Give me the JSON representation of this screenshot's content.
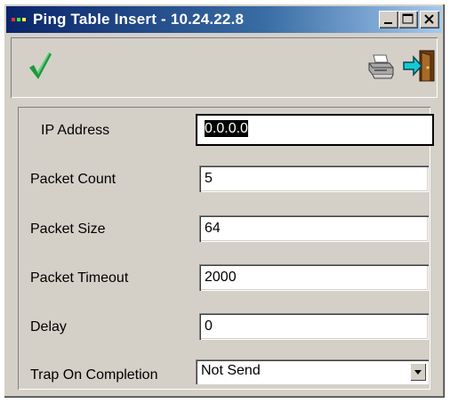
{
  "window": {
    "title": "Ping Table Insert - 10.24.22.8"
  },
  "form": {
    "ip_address": {
      "label": "IP Address",
      "value": "0.0.0.0"
    },
    "packet_count": {
      "label": "Packet Count",
      "value": "5"
    },
    "packet_size": {
      "label": "Packet Size",
      "value": "64"
    },
    "packet_timeout": {
      "label": "Packet Timeout",
      "value": "2000"
    },
    "delay": {
      "label": "Delay",
      "value": "0"
    },
    "trap_on_completion": {
      "label": "Trap On Completion",
      "value": "Not Send"
    }
  },
  "icons": {
    "check": "checkmark-icon",
    "printer": "printer-icon",
    "exit": "exit-door-icon"
  },
  "colors": {
    "title_start": "#0a246a",
    "title_end": "#a6caf0",
    "check_green": "#1a9a3a",
    "window_bg": "#d4d0c8"
  }
}
